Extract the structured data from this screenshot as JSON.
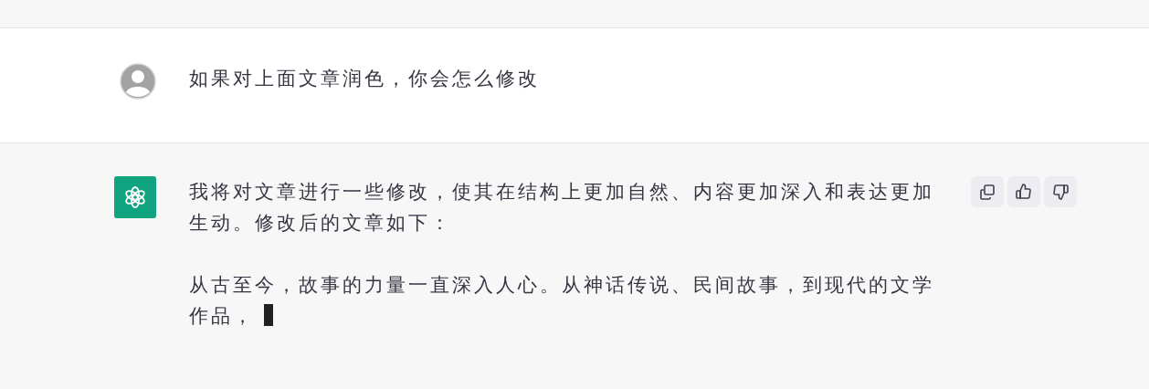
{
  "messages": [
    {
      "kind": "user",
      "paragraphs": [
        "如果对上面文章润色，你会怎么修改"
      ],
      "streaming": false
    },
    {
      "kind": "assistant",
      "paragraphs": [
        "我将对文章进行一些修改，使其在结构上更加自然、内容更加深入和表达更加生动。修改后的文章如下：",
        "从古至今，故事的力量一直深入人心。从神话传说、民间故事，到现代的文学作品，"
      ],
      "streaming": true
    }
  ]
}
